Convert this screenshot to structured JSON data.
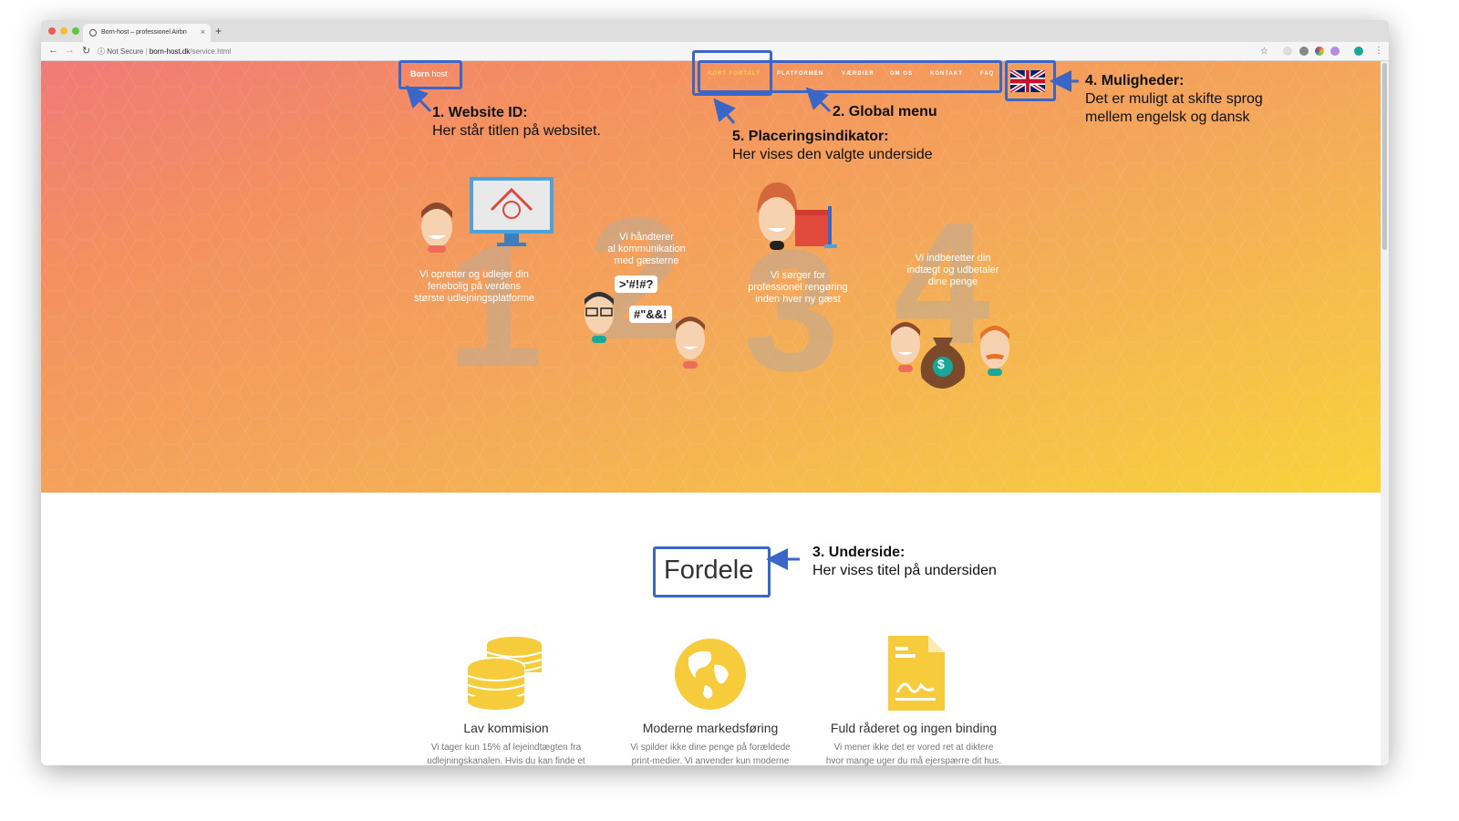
{
  "browser": {
    "tab_title": "Born-host – professionel Airbn",
    "tab_close": "×",
    "new_tab": "+",
    "secure_label": "Not Secure",
    "url_host": "born-host.dk",
    "url_path": "/service.html",
    "url_separator": "|"
  },
  "site": {
    "brand_bold": "Born",
    "brand_light": "host",
    "menu": [
      "KORT FORTALT",
      "PLATFORMEN",
      "VÆRDIER",
      "OM OS",
      "KONTAKT",
      "FAQ"
    ],
    "language_flag": "uk-flag-icon"
  },
  "steps": [
    {
      "number": "1",
      "text_lines": [
        "Vi opretter og udlejer din",
        "feriebolig på verdens",
        "største udlejningsplatforme"
      ]
    },
    {
      "number": "2",
      "text_lines": [
        "Vi håndterer",
        "al kommunikation",
        "med gæsterne"
      ]
    },
    {
      "number": "3",
      "text_lines": [
        "Vi sørger for",
        "professionel rengøring",
        "inden hver ny gæst"
      ]
    },
    {
      "number": "4",
      "text_lines": [
        "Vi indberetter din",
        "indtægt og udbetaler",
        "dine penge"
      ]
    }
  ],
  "bubbles": [
    ">'#!#?",
    "#\"&&!"
  ],
  "money_symbol": "$",
  "annotations": {
    "a1_title": "1. Website ID:",
    "a1_text": "Her står titlen på websitet.",
    "a2_title": "2. Global menu",
    "a3_title": "3. Underside:",
    "a3_text": "Her vises titel på undersiden",
    "a4_title": "4. Muligheder:",
    "a4_text1": "Det er muligt at skifte sprog",
    "a4_text2": "mellem engelsk og dansk",
    "a5_title": "5. Placeringsindikator:",
    "a5_text": "Her vises den valgte underside"
  },
  "section": {
    "title": "Fordele",
    "features": [
      {
        "title": "Lav kommision",
        "icon": "coins-icon",
        "text_lines": [
          "Vi tager kun 15% af lejeindtægten fra",
          "udlejningskanalen. Hvis du kan finde et"
        ]
      },
      {
        "title": "Moderne markedsføring",
        "icon": "globe-icon",
        "text_lines": [
          "Vi spilder ikke dine penge på forældede",
          "print-medier. Vi anvender kun moderne"
        ]
      },
      {
        "title": "Fuld råderet og ingen binding",
        "icon": "document-icon",
        "text_lines": [
          "Vi mener ikke det er vored ret at diktere",
          "hvor mange uger du må ejerspærre dit hus."
        ]
      }
    ]
  },
  "colors": {
    "annotation_blue": "#3a66c8",
    "icon_yellow": "#f6cc3c",
    "active_menu": "#ffd04a"
  }
}
